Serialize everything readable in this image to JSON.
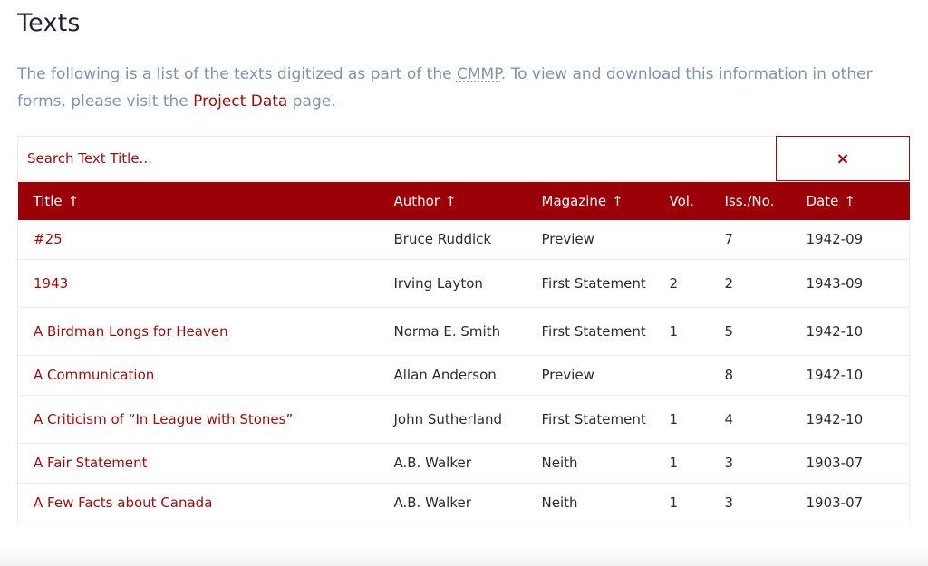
{
  "heading": "Texts",
  "intro": {
    "before": "The following is a list of the texts digitized as part of the ",
    "abbr": "CMMP",
    "middle": ". To view and download this information in other forms, please visit the ",
    "link": "Project Data",
    "after": " page."
  },
  "search": {
    "placeholder": "Search Text Title...",
    "clear_icon": "×"
  },
  "columns": [
    {
      "label": "Title",
      "sort": "↑"
    },
    {
      "label": "Author",
      "sort": "↑"
    },
    {
      "label": "Magazine",
      "sort": "↑"
    },
    {
      "label": "Vol.",
      "sort": ""
    },
    {
      "label": "Iss./No.",
      "sort": ""
    },
    {
      "label": "Date",
      "sort": "↑"
    }
  ],
  "rows": [
    {
      "title": "#25",
      "author": "Bruce Ruddick",
      "magazine": "Preview",
      "vol": "",
      "issue": "7",
      "date": "1942-09"
    },
    {
      "title": "1943",
      "author": "Irving Layton",
      "magazine": "First Statement",
      "vol": "2",
      "issue": "2",
      "date": "1943-09"
    },
    {
      "title": "A Birdman Longs for Heaven",
      "author": "Norma E. Smith",
      "magazine": "First Statement",
      "vol": "1",
      "issue": "5",
      "date": "1942-10"
    },
    {
      "title": "A Communication",
      "author": "Allan Anderson",
      "magazine": "Preview",
      "vol": "",
      "issue": "8",
      "date": "1942-10"
    },
    {
      "title": "A Criticism of “In League with Stones”",
      "author": "John Sutherland",
      "magazine": "First Statement",
      "vol": "1",
      "issue": "4",
      "date": "1942-10"
    },
    {
      "title": "A Fair Statement",
      "author": "A.B. Walker",
      "magazine": "Neith",
      "vol": "1",
      "issue": "3",
      "date": "1903-07"
    },
    {
      "title": "A Few Facts about Canada",
      "author": "A.B. Walker",
      "magazine": "Neith",
      "vol": "1",
      "issue": "3",
      "date": "1903-07"
    }
  ]
}
